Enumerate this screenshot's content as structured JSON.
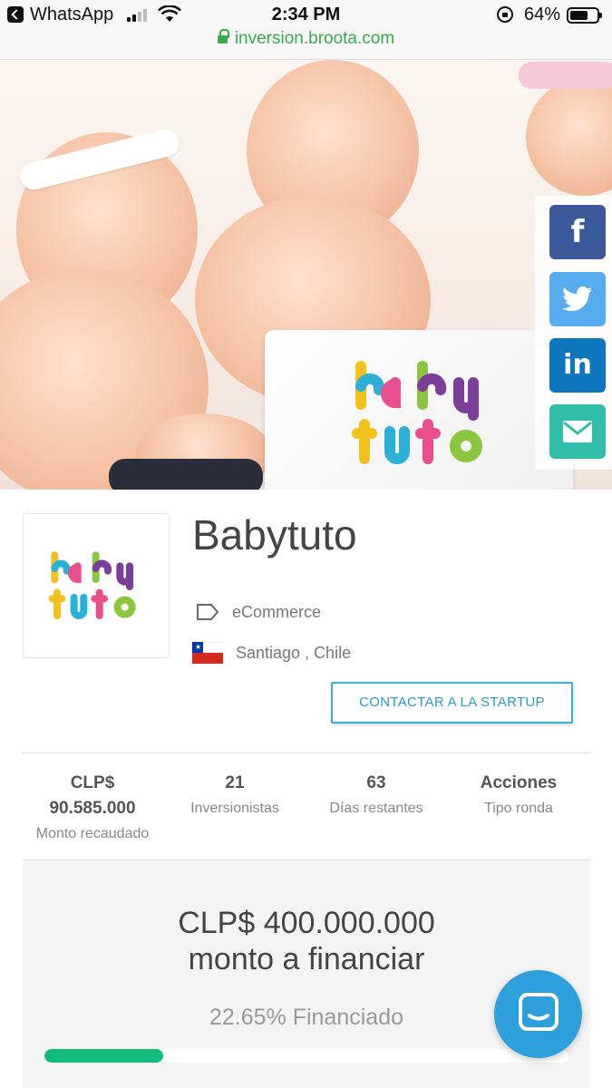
{
  "status_bar": {
    "back_app": "WhatsApp",
    "time": "2:34 PM",
    "battery_percent": "64%",
    "signal_icon": "cellular-signal-icon",
    "wifi_icon": "wifi-icon",
    "rotation_lock_icon": "rotation-lock-icon",
    "battery_level": 0.64
  },
  "browser": {
    "url": "inversion.broota.com",
    "secure": true
  },
  "hero": {
    "logo_line1": "baby",
    "logo_line2": "tuto"
  },
  "social_share": [
    {
      "name": "facebook",
      "glyph": "f",
      "color": "#3b5998"
    },
    {
      "name": "twitter",
      "glyph": "twitter-bird",
      "color": "#55acee"
    },
    {
      "name": "linkedin",
      "glyph": "in",
      "color": "#0e76bd"
    },
    {
      "name": "email",
      "glyph": "envelope",
      "color": "#2fbfa8"
    }
  ],
  "company": {
    "name": "Babytuto",
    "category": "eCommerce",
    "location": "Santiago , Chile",
    "contact_button": "CONTACTAR A LA STARTUP"
  },
  "stats": [
    {
      "value": "CLP$\n90.585.000",
      "value_line1": "CLP$",
      "value_line2": "90.585.000",
      "label": "Monto recaudado"
    },
    {
      "value": "21",
      "label": "Inversionistas"
    },
    {
      "value": "63",
      "label": "Días restantes"
    },
    {
      "value": "Acciones",
      "label": "Tipo ronda"
    }
  ],
  "funding": {
    "goal_line1": "CLP$ 400.000.000",
    "goal_line2": "monto a financiar",
    "percent_text": "22.65% Financiado",
    "percent": 22.65
  },
  "colors": {
    "accent": "#2a9bc4",
    "progress": "#12bb79",
    "chat": "#2d9fdb",
    "url_green": "#3aaa4f"
  }
}
